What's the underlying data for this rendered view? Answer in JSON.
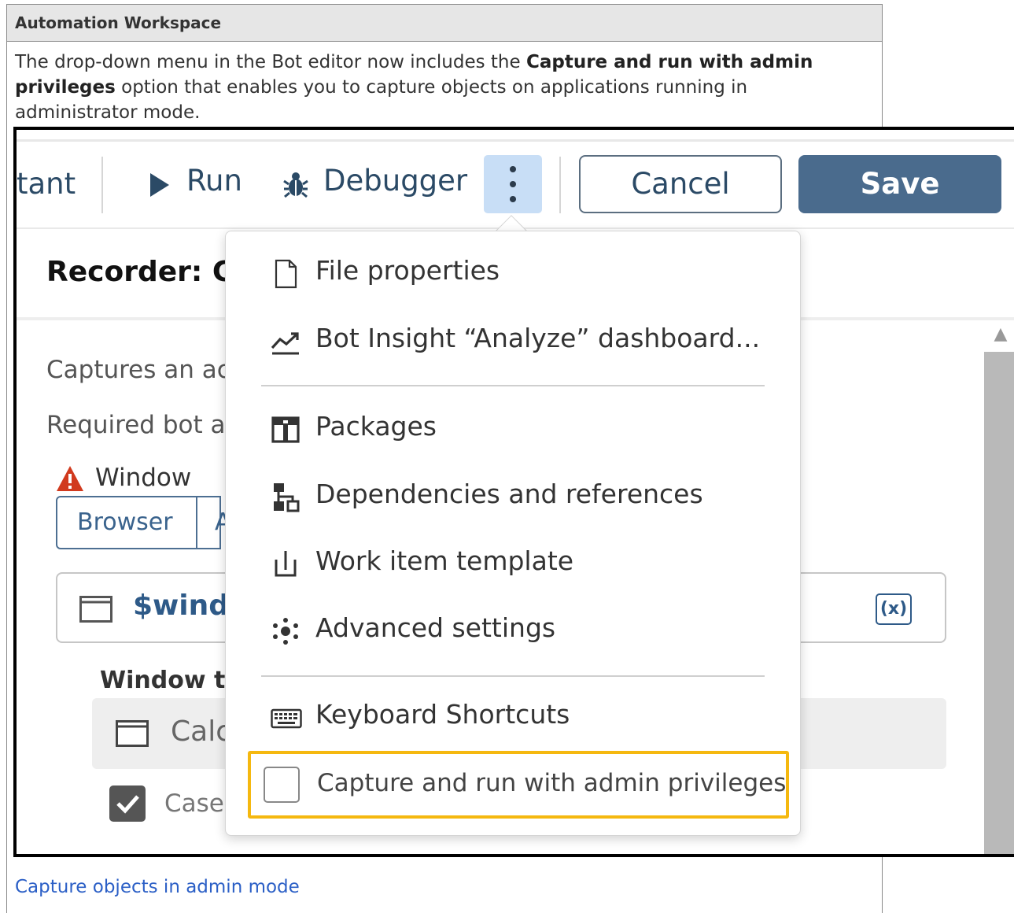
{
  "doc": {
    "header": "Automation Workspace",
    "desc_pre": "The drop-down menu in the Bot editor now includes the ",
    "desc_bold": "Capture and run with admin privileges",
    "desc_post": " option that enables you to capture objects on applications running in administrator mode.",
    "caption_link": "Capture objects in admin mode"
  },
  "toolbar": {
    "partial_tab": "tant",
    "run": "Run",
    "debugger": "Debugger",
    "cancel": "Cancel",
    "save": "Save"
  },
  "editor": {
    "recorder_title": "Recorder: Ca",
    "captures_text": "Captures an ac",
    "required_text": "Required bot a",
    "window_label": "Window",
    "segment_browser": "Browser",
    "segment_next": "A",
    "window_var": "$wind",
    "var_button": "(x)",
    "window_title_label": "Window ti",
    "window_title_value": "Calc",
    "case_label": "Case"
  },
  "menu": {
    "file_properties": "File properties",
    "bot_insight": "Bot Insight “Analyze” dashboard...",
    "packages": "Packages",
    "dependencies": "Dependencies and references",
    "work_item": "Work item template",
    "advanced": "Advanced settings",
    "shortcuts": "Keyboard Shortcuts",
    "admin": "Capture and run with admin privileges",
    "admin_checked": false
  },
  "colors": {
    "save_bg": "#4a6b8d",
    "highlight": "#f5b80f",
    "link": "#2b5fc6",
    "kebab_bg": "#c8def6",
    "warning": "#d13a1e"
  }
}
